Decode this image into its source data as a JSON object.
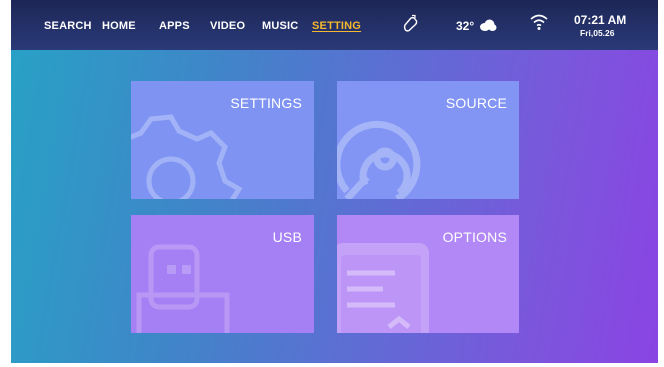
{
  "nav": {
    "items": [
      {
        "label": "SEARCH"
      },
      {
        "label": "HOME"
      },
      {
        "label": "APPS"
      },
      {
        "label": "VIDEO"
      },
      {
        "label": "MUSIC"
      },
      {
        "label": "SETTING"
      }
    ],
    "active": "SETTING",
    "active_color": "#f5b82e"
  },
  "status": {
    "temperature": "32°",
    "weather_icon": "cloud-icon",
    "wifi_icon": "wifi-icon",
    "orientation_icon": "rotate-icon",
    "time": "07:21 AM",
    "date": "Fri,05.26"
  },
  "tiles": [
    {
      "label": "SETTINGS",
      "icon": "gear-icon",
      "color": "#7f94f2"
    },
    {
      "label": "SOURCE",
      "icon": "source-disc-icon",
      "color": "#8295f4"
    },
    {
      "label": "USB",
      "icon": "usb-icon",
      "color": "#a57ff4"
    },
    {
      "label": "OPTIONS",
      "icon": "document-icon",
      "color": "#b188f6"
    }
  ]
}
